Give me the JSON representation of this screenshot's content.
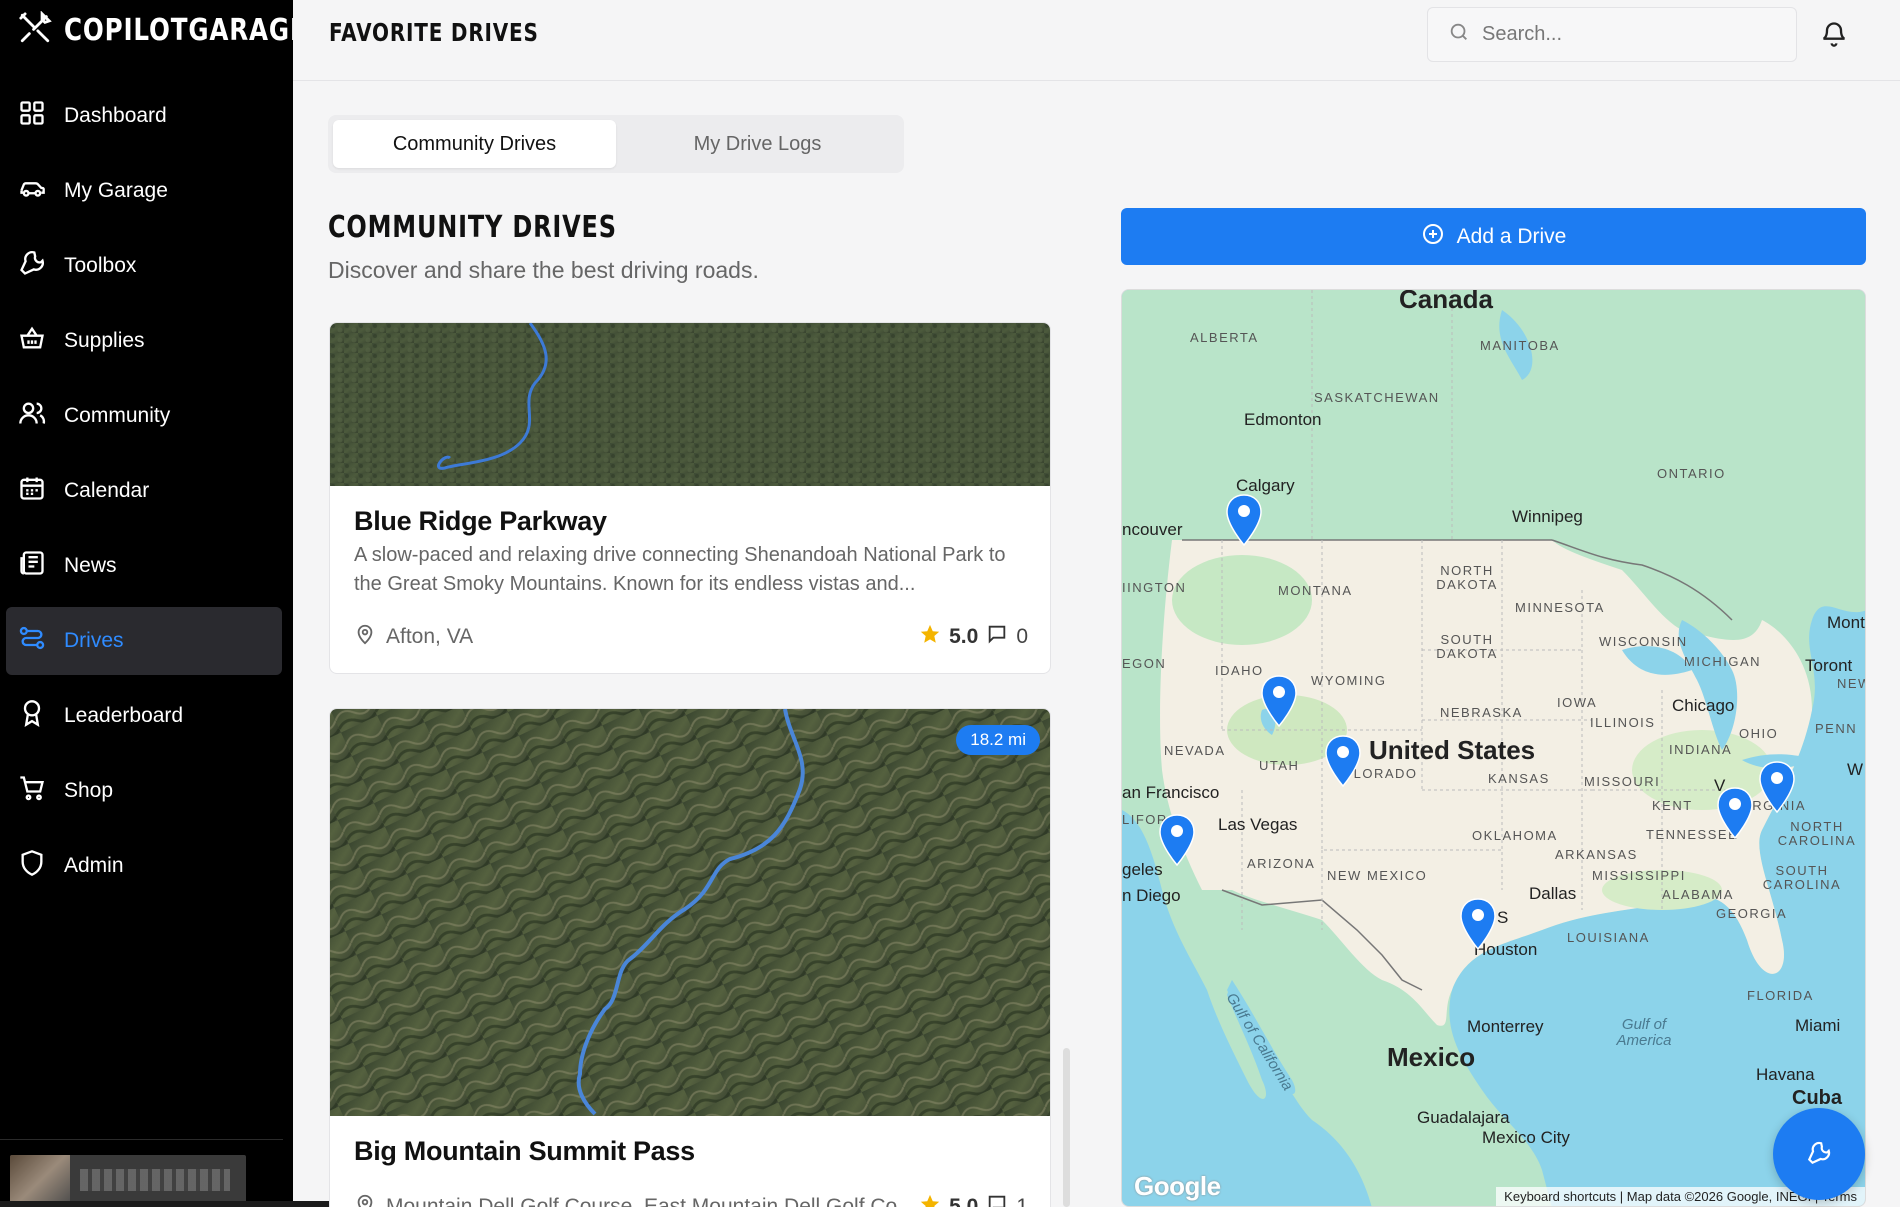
{
  "brand": {
    "name": "COPILOTGARAGE"
  },
  "sidebar": {
    "items": [
      {
        "label": "Dashboard",
        "icon": "grid-icon"
      },
      {
        "label": "My Garage",
        "icon": "car-icon"
      },
      {
        "label": "Toolbox",
        "icon": "wrench-icon"
      },
      {
        "label": "Supplies",
        "icon": "basket-icon"
      },
      {
        "label": "Community",
        "icon": "users-icon"
      },
      {
        "label": "Calendar",
        "icon": "calendar-icon"
      },
      {
        "label": "News",
        "icon": "newspaper-icon"
      },
      {
        "label": "Drives",
        "icon": "route-icon",
        "active": true
      },
      {
        "label": "Leaderboard",
        "icon": "award-icon"
      },
      {
        "label": "Shop",
        "icon": "cart-icon"
      },
      {
        "label": "Admin",
        "icon": "shield-icon"
      }
    ]
  },
  "header": {
    "title": "FAVORITE DRIVES",
    "search_placeholder": "Search..."
  },
  "tabs": [
    {
      "label": "Community Drives",
      "active": true
    },
    {
      "label": "My Drive Logs",
      "active": false
    }
  ],
  "section": {
    "title": "COMMUNITY DRIVES",
    "subtitle": "Discover and share the best driving roads."
  },
  "drives": [
    {
      "title": "Blue Ridge Parkway",
      "description": "A slow-paced and relaxing drive connecting Shenandoah National Park to the Great Smoky Mountains. Known for its endless vistas and...",
      "location": "Afton, VA",
      "rating": "5.0",
      "comments": "0"
    },
    {
      "title": "Big Mountain Summit Pass",
      "distance": "18.2 mi",
      "location": "Mountain Dell Golf Course, East Mountain Dell Golf Co...",
      "rating": "5.0",
      "comments": "1"
    }
  ],
  "actions": {
    "add_drive": "Add a Drive"
  },
  "map": {
    "countries": [
      "Canada",
      "United States",
      "Mexico",
      "Cuba"
    ],
    "states": [
      "ALBERTA",
      "MANITOBA",
      "SASKATCHEWAN",
      "ONTARIO",
      "MONTANA",
      "NORTH DAKOTA",
      "MINNESOTA",
      "SOUTH DAKOTA",
      "WISCONSIN",
      "MICHIGAN",
      "IDAHO",
      "WYOMING",
      "NEBRASKA",
      "IOWA",
      "ILLINOIS",
      "OHIO",
      "PENN",
      "NEVADA",
      "UTAH",
      "OLORADO",
      "KANSAS",
      "MISSOURI",
      "INDIANA",
      "KENT",
      "VIRGINIA",
      "TENNESSEE",
      "NORTH CAROLINA",
      "OKLAHOMA",
      "ARKANSAS",
      "ARIZONA",
      "NEW MEXICO",
      "MISSISSIPPI",
      "ALABAMA",
      "GEORGIA",
      "SOUTH CAROLINA",
      "LOUISIANA",
      "FLORIDA",
      "EGON",
      "IINGTON",
      "LIFOR",
      "NEW"
    ],
    "cities": [
      "Edmonton",
      "Calgary",
      "Winnipeg",
      "ncouver",
      "Chicago",
      "Toront",
      "Mont",
      "an Francisco",
      "Las Vegas",
      "geles",
      "n Diego",
      "Dallas",
      "Houston",
      "Monterrey",
      "Miami",
      "Havana",
      "Guadalajara",
      "Mexico City",
      "S",
      "W",
      "V"
    ],
    "water": [
      "Gulf of California",
      "Gulf of America"
    ],
    "attribution": "Keyboard shortcuts | Map data ©2026 Google, INEGI | Terms",
    "logo": "Google"
  },
  "colors": {
    "accent": "#1d7cf2",
    "sidebar_bg": "#000000",
    "active_bg": "#2a2a2f"
  }
}
